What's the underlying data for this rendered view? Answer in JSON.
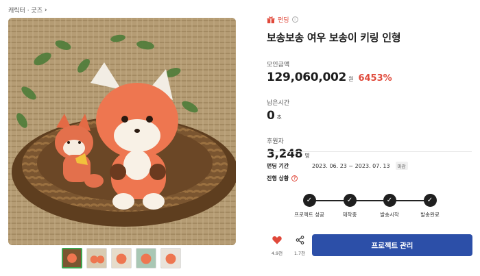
{
  "breadcrumb": {
    "text": "캐릭터 · 굿즈",
    "chevron_icon": "chevron-right-icon"
  },
  "badge": {
    "label": "펀딩",
    "icon": "gift-icon",
    "info_icon": "info-icon"
  },
  "title": "보송보송 여우 보송이 키링 인형",
  "stats": {
    "amount": {
      "label": "모인금액",
      "value": "129,060,002",
      "unit": "원",
      "percent": "6453%"
    },
    "time_left": {
      "label": "남은시간",
      "value": "0",
      "unit": "초"
    },
    "backers": {
      "label": "후원자",
      "value": "3,248",
      "unit": "명"
    }
  },
  "period": {
    "label": "펀딩 기간",
    "value": "2023. 06. 23 ~ 2023. 07. 13",
    "tag": "마감"
  },
  "progress": {
    "label": "진행 상황",
    "steps": [
      "프로젝트 성공",
      "제작중",
      "발송시작",
      "발송완료"
    ]
  },
  "actions": {
    "like_count": "4.9천",
    "share_count": "1.7천",
    "manage_label": "프로젝트 관리"
  },
  "colors": {
    "accent": "#2c4fa8",
    "highlight": "#e04a3b",
    "active_thumb": "#3fa34d"
  }
}
